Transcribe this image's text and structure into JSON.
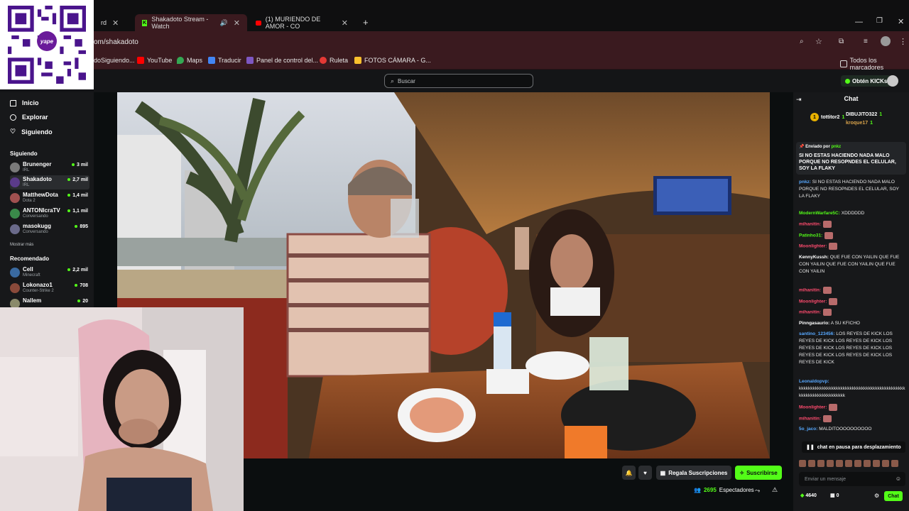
{
  "browser": {
    "tabs": [
      {
        "label": "rd",
        "active": false
      },
      {
        "label": "Shakadoto Stream - Watch",
        "active": true
      },
      {
        "label": "(1) MURIENDO DE AMOR - CO",
        "active": false
      }
    ],
    "url": "om/shakadoto",
    "bookmarks": [
      "doSiguiendo...",
      "YouTube",
      "Maps",
      "Traducir",
      "Panel de control del...",
      "Ruleta",
      "FOTOS CÁMARA - G..."
    ],
    "all_bookmarks": "Todos los marcadores"
  },
  "header": {
    "search_placeholder": "Buscar",
    "get_kicks": "Obtén KICKs"
  },
  "qr": {
    "brand": "yape"
  },
  "nav": {
    "items": [
      "Inicio",
      "Explorar",
      "Siguiendo"
    ],
    "following_title": "Siguiendo",
    "following": [
      {
        "name": "Brunenger",
        "category": "IRL",
        "viewers": "3 mil",
        "color": "#7a7a7a"
      },
      {
        "name": "Shakadoto",
        "category": "IRL",
        "viewers": "2,7 mil",
        "color": "#5b3b8a"
      },
      {
        "name": "MatthewDota",
        "category": "Dota 2",
        "viewers": "1,4 mil",
        "color": "#a05050"
      },
      {
        "name": "ANTONIcraTV",
        "category": "Conversando",
        "viewers": "1,1 mil",
        "color": "#3a8a4a"
      },
      {
        "name": "masokugg",
        "category": "Conversando",
        "viewers": "895",
        "color": "#6a6a8a"
      }
    ],
    "show_more": "Mostrar más",
    "recommended_title": "Recomendado",
    "recommended": [
      {
        "name": "Cell",
        "category": "Minecraft",
        "viewers": "2,2 mil",
        "color": "#3a6aa0"
      },
      {
        "name": "Lokonazo1",
        "category": "Counter-Strike 2",
        "viewers": "708",
        "color": "#8a4a3a"
      },
      {
        "name": "Nallem",
        "category": "",
        "viewers": "20",
        "color": "#8a8a6a"
      }
    ]
  },
  "player": {
    "gift_subs": "Regala Suscripciones",
    "subscribe": "Suscribirse",
    "viewer_count": "2695",
    "viewer_label": "Espectadores"
  },
  "chat": {
    "title": "Chat",
    "gifters": [
      {
        "name": "tottitor2",
        "count": "1"
      },
      {
        "name": "DIBUJITO322",
        "count": "1"
      },
      {
        "name": "kroque17",
        "count": "1"
      }
    ],
    "pinned_by_label": "Enviado por",
    "pinned_by_user": "pnkz",
    "pinned_text": "SI NO ESTAS HACIENDO NADA MALO PORQUE NO RESOPNDES EL CELULAR, SOY LA FLAKY",
    "messages": [
      {
        "user": "pnkz:",
        "text": "SI NO ESTAS HACIENDO NADA MALO PORQUE NO RESOPNDES EL CELULAR, SOY LA FLAKY",
        "color": "#57a8ff"
      },
      {
        "user": "ModernWarfare5C:",
        "text": "XDDDDDD",
        "color": "#53fc18"
      },
      {
        "user": "mihanitin:",
        "text": "",
        "color": "#ff4b6e"
      },
      {
        "user": "Patinho31:",
        "text": "",
        "color": "#53fc18"
      },
      {
        "user": "Moonlighter:",
        "text": "",
        "color": "#ff4b6e"
      },
      {
        "user": "KennyKussh:",
        "text": "QUE FUE CON YAILIN QUE FUE CON YAILIN QUE FUE CON YAILIN QUE FUE CON YAILIN",
        "color": "#ffffff"
      },
      {
        "user": "mihanitin:",
        "text": "",
        "color": "#ff4b6e"
      },
      {
        "user": "Moonlighter:",
        "text": "",
        "color": "#ff4b6e"
      },
      {
        "user": "mihanitin:",
        "text": "",
        "color": "#ff4b6e"
      },
      {
        "user": "Pinngasaurio:",
        "text": "A SU KFICHO",
        "color": "#ffffff"
      },
      {
        "user": "santino_123456:",
        "text": "LOS REYES DE KICK LOS REYES DE KICK LOS REYES DE KICK LOS REYES DE KICK LOS REYES DE KICK LOS REYES DE KICK LOS REYES DE KICK LOS REYES DE KICK",
        "color": "#57a8ff"
      },
      {
        "user": "Leonaldopvp:",
        "text": "kkkkkkkkkkkkkkkkkkkkkkkkkkkkkkkkkkkkkkkkkkkkkkkkkkkkkkkkkkkkkkkkkk",
        "color": "#57a8ff"
      },
      {
        "user": "Moonlighter:",
        "text": "",
        "color": "#ff4b6e"
      },
      {
        "user": "mihanitin:",
        "text": "",
        "color": "#ff4b6e"
      },
      {
        "user": "5o_jaco:",
        "text": "MALDITOOOOOOOOOO",
        "color": "#57a8ff"
      }
    ],
    "paused": "chat en pausa para desplazamiento",
    "input_placeholder": "Enviar un mensaje",
    "kicks": "4640",
    "gifts": "0",
    "chat_button": "Chat"
  }
}
